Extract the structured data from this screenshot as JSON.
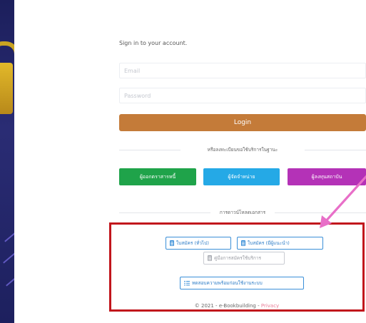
{
  "signin": {
    "title": "Sign in to your account.",
    "email_placeholder": "Email",
    "password_placeholder": "Password",
    "login_label": "Login"
  },
  "register": {
    "divider_text": "หรือลงทะเบียนขอใช้บริการในฐานะ",
    "issuer_label": "ผู้ออกตราสารหนี้",
    "distributor_label": "ผู้จัดจำหน่าย",
    "institution_label": "ผู้ลงทุนสถาบัน"
  },
  "downloads": {
    "divider_text": "การดาวน์โหลดเอกสาร",
    "general_form_label": "ใบสมัคร (ทั่วไป)",
    "advisor_form_label": "ใบสมัคร (มีผู้แนะนำ)",
    "manual_label": "คู่มือการสมัครใช้บริการ",
    "readiness_test_label": "ทดสอบความพร้อมก่อนใช้งานระบบ"
  },
  "footer": {
    "copyright": "© 2021 - e-Bookbuilding - ",
    "privacy_link": "Privacy"
  },
  "colors": {
    "login": "#c47b39",
    "issuer": "#1fa34a",
    "distributor": "#25a9e6",
    "institution": "#b432b7",
    "highlight_box": "#c1161c",
    "annotation_arrow": "#e86fc8"
  },
  "icons": [
    "document-icon",
    "list-icon",
    "lock-icon",
    "arrow-annotation"
  ]
}
